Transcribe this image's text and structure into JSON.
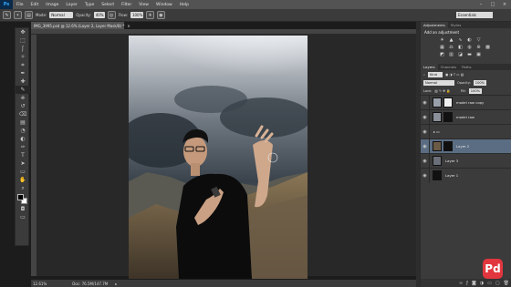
{
  "app": {
    "logo": "Ps"
  },
  "menu": [
    "File",
    "Edit",
    "Image",
    "Layer",
    "Type",
    "Select",
    "Filter",
    "View",
    "Window",
    "Help"
  ],
  "window_controls": [
    "–",
    "□",
    "×"
  ],
  "options": {
    "mode_label": "Mode:",
    "mode_value": "Normal",
    "opacity_label": "Opacity:",
    "opacity_value": "40%",
    "flow_label": "Flow:",
    "flow_value": "100%",
    "workspace": "Essentials"
  },
  "document": {
    "tab_title": "IMG_3995.psd @ 12.6% (Layer 2, Layer Mask/8) *",
    "zoom": "12.61%",
    "doc_size": "Doc: 76.5M/147.7M"
  },
  "panels": {
    "top_tabs": [
      "Adjustments",
      "Styles"
    ],
    "adjustments_title": "Add an adjustment",
    "layer_tabs": [
      "Layers",
      "Channels",
      "Paths"
    ],
    "kind_label": "Kind",
    "blend_mode": "Normal",
    "opacity_label": "Opacity:",
    "opacity_value": "100%",
    "lock_label": "Lock:",
    "fill_label": "Fill:",
    "fill_value": "100%",
    "layers": [
      {
        "name": "model raw copy",
        "selected": false,
        "thumb_color": "#9aa0aa",
        "mask": "#f0f0f0"
      },
      {
        "name": "model raw",
        "selected": false,
        "thumb_color": "#8a8f99",
        "mask": "#111111"
      },
      {
        "name": "",
        "selected": false,
        "thumb_color": "",
        "mask": ""
      },
      {
        "name": "Layer 2",
        "selected": true,
        "thumb_color": "#6b5a45",
        "mask": "#101010"
      },
      {
        "name": "Layer 3",
        "selected": false,
        "thumb_color": "#6a6f79",
        "mask": ""
      },
      {
        "name": "Layer 1",
        "selected": false,
        "thumb_color": "#111111",
        "mask": ""
      }
    ]
  },
  "watermark": {
    "text": "Pd",
    "color": "#e2363e"
  },
  "icons": {
    "eye": "eye-icon",
    "tools": [
      "move-icon",
      "marquee-icon",
      "lasso-icon",
      "quick-select-icon",
      "crop-icon",
      "eyedropper-icon",
      "healing-icon",
      "brush-icon",
      "clone-stamp-icon",
      "history-brush-icon",
      "eraser-icon",
      "gradient-icon",
      "blur-icon",
      "dodge-icon",
      "pen-icon",
      "type-icon",
      "path-select-icon",
      "shape-icon",
      "hand-icon",
      "zoom-icon"
    ]
  }
}
